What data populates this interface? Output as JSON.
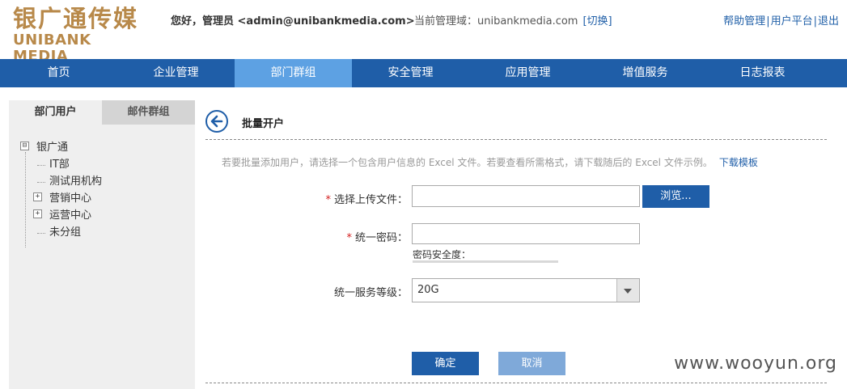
{
  "header": {
    "logo_cn": "银广通传媒",
    "logo_en": "UNIBANK MEDIA",
    "greeting": "您好，管理员 <admin@unibankmedia.com>",
    "domain_label": "当前管理域：unibankmedia.com",
    "domain_switch": "[切换]",
    "links": [
      "帮助管理",
      "用户平台",
      "退出"
    ],
    "link_separator": "|"
  },
  "nav": {
    "items": [
      "首页",
      "企业管理",
      "部门群组",
      "安全管理",
      "应用管理",
      "增值服务",
      "日志报表"
    ],
    "active": "部门群组"
  },
  "sidebar": {
    "tabs": [
      "部门用户",
      "邮件群组"
    ],
    "active_tab": "部门用户",
    "tree": {
      "root": "银广通",
      "root_expander": "⊟",
      "children": [
        {
          "label": "IT部",
          "expander": ""
        },
        {
          "label": "测试用机构",
          "expander": ""
        },
        {
          "label": "营销中心",
          "expander": "+"
        },
        {
          "label": "运营中心",
          "expander": "+"
        },
        {
          "label": "未分组",
          "expander": ""
        }
      ]
    }
  },
  "main": {
    "title": "批量开户",
    "description": "若要批量添加用户，请选择一个包含用户信息的 Excel 文件。若要查看所需格式，请下载随后的 Excel 文件示例。",
    "download_link": "下载模板",
    "form": {
      "required_mark": "*",
      "file_label": "选择上传文件：",
      "file_value": "",
      "browse_label": "浏览...",
      "password_label": "统一密码：",
      "password_value": "",
      "strength_label": "密码安全度：",
      "strength_level": 0,
      "service_label": "统一服务等级：",
      "service_value": "20G"
    },
    "buttons": {
      "ok": "确定",
      "cancel": "取消"
    }
  },
  "watermark": "www.wooyun.org",
  "colors": {
    "brand_blue": "#1f5ea8",
    "nav_active": "#5da1e3",
    "logo_gold": "#b8894a",
    "required_red": "#d42020"
  }
}
